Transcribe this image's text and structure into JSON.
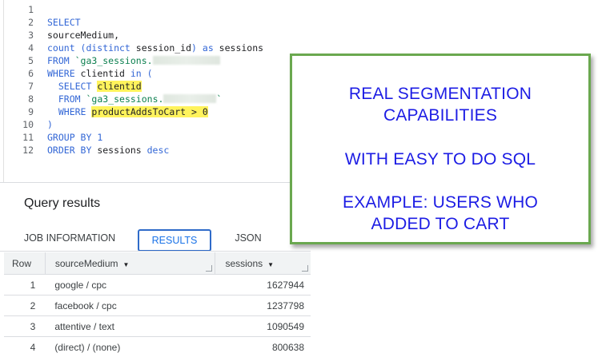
{
  "editor": {
    "lines": [
      {
        "num": "1"
      },
      {
        "num": "2",
        "tokens": [
          {
            "t": "SELECT",
            "c": "kw"
          }
        ]
      },
      {
        "num": "3",
        "tokens": [
          {
            "t": "sourceMedium,",
            "c": "plain"
          }
        ]
      },
      {
        "num": "4",
        "tokens": [
          {
            "t": "count (distinct ",
            "c": "kw"
          },
          {
            "t": "session_id",
            "c": "plain"
          },
          {
            "t": ") ",
            "c": "kw"
          },
          {
            "t": "as",
            "c": "kw"
          },
          {
            "t": " sessions",
            "c": "plain"
          }
        ]
      },
      {
        "num": "5",
        "tokens": [
          {
            "t": "FROM ",
            "c": "kw"
          },
          {
            "t": "`ga3_sessions.",
            "c": "str"
          }
        ],
        "blur": 84
      },
      {
        "num": "6",
        "tokens": [
          {
            "t": "WHERE ",
            "c": "kw"
          },
          {
            "t": "clientid ",
            "c": "plain"
          },
          {
            "t": "in (",
            "c": "kw"
          }
        ]
      },
      {
        "num": "7",
        "tokens": [
          {
            "t": "  ",
            "c": "plain"
          },
          {
            "t": "SELECT ",
            "c": "kw"
          },
          {
            "t": "clientid",
            "c": "plain hl"
          }
        ]
      },
      {
        "num": "8",
        "tokens": [
          {
            "t": "  ",
            "c": "plain"
          },
          {
            "t": "FROM ",
            "c": "kw"
          },
          {
            "t": "`ga3_sessions.",
            "c": "str"
          }
        ],
        "blur": 66,
        "tail": "`"
      },
      {
        "num": "9",
        "tokens": [
          {
            "t": "  ",
            "c": "plain"
          },
          {
            "t": "WHERE ",
            "c": "kw"
          },
          {
            "t": "productAddsToCart > 0",
            "c": "plain hl"
          }
        ]
      },
      {
        "num": "10",
        "tokens": [
          {
            "t": ")",
            "c": "kw"
          }
        ]
      },
      {
        "num": "11",
        "tokens": [
          {
            "t": "GROUP BY ",
            "c": "kw"
          },
          {
            "t": "1",
            "c": "num"
          }
        ]
      },
      {
        "num": "12",
        "tokens": [
          {
            "t": "ORDER BY ",
            "c": "kw"
          },
          {
            "t": "sessions ",
            "c": "plain"
          },
          {
            "t": "desc",
            "c": "kw"
          }
        ]
      }
    ]
  },
  "results": {
    "title": "Query results",
    "tabs": {
      "job": "JOB INFORMATION",
      "results": "RESULTS",
      "json": "JSON"
    },
    "columns": {
      "row": "Row",
      "source": "sourceMedium",
      "sessions": "sessions"
    },
    "rows": [
      {
        "row": "1",
        "source": "google / cpc",
        "sessions": "1627944"
      },
      {
        "row": "2",
        "source": "facebook / cpc",
        "sessions": "1237798"
      },
      {
        "row": "3",
        "source": "attentive / text",
        "sessions": "1090549"
      },
      {
        "row": "4",
        "source": "(direct) / (none)",
        "sessions": "800638"
      }
    ]
  },
  "callout": {
    "line1": "REAL SEGMENTATION",
    "line2": "CAPABILITIES",
    "line3": "WITH EASY TO DO SQL",
    "line4": "EXAMPLE: USERS WHO",
    "line5": "ADDED TO CART"
  },
  "colors": {
    "keyword": "#3367d6",
    "string": "#0d8050",
    "highlight": "#fff35c",
    "callout_text": "#1c1ce4",
    "callout_border": "#6aa84f",
    "active_tab": "#1a73e8"
  }
}
